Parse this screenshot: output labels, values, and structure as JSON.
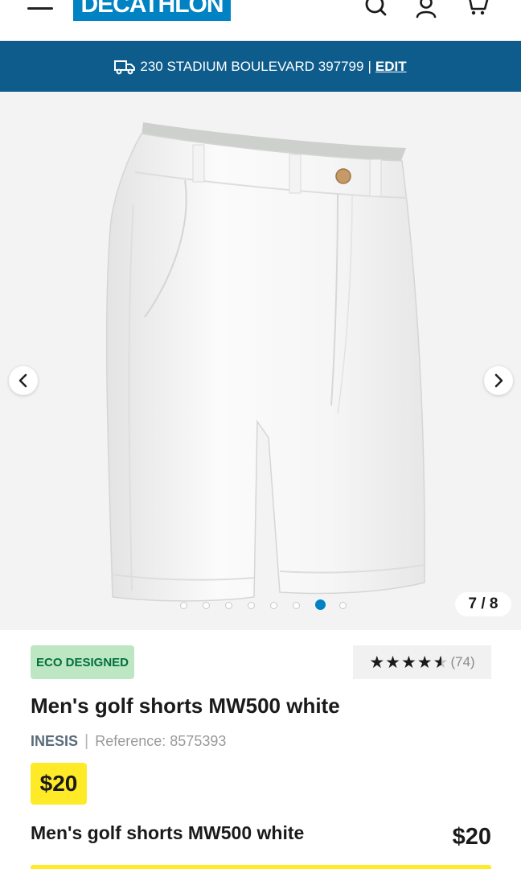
{
  "header": {
    "brand": "DECATHLON",
    "icons": [
      "menu-icon",
      "search-icon",
      "account-icon",
      "cart-icon"
    ]
  },
  "address_bar": {
    "address": "230 STADIUM BOULEVARD 397799",
    "separator": "|",
    "edit_label": "EDIT"
  },
  "gallery": {
    "counter": "7 / 8",
    "current_index": 7,
    "total": 8
  },
  "product": {
    "badge": "ECO DESIGNED",
    "stars": "★★★★★",
    "rating_value": 4.5,
    "review_count": "(74)",
    "title": "Men's golf shorts MW500 white",
    "brand": "INESIS",
    "divider": "|",
    "reference": "Reference: 8575393",
    "price": "$20"
  },
  "sticky": {
    "title": "Men's golf shorts MW500 white",
    "price": "$20"
  },
  "colors": {
    "brand_blue": "#0082c3",
    "address_bar": "#0d5c8c",
    "price_yellow": "#ffea28",
    "eco_green_bg": "#bde6c3",
    "eco_green_text": "#00703c"
  }
}
